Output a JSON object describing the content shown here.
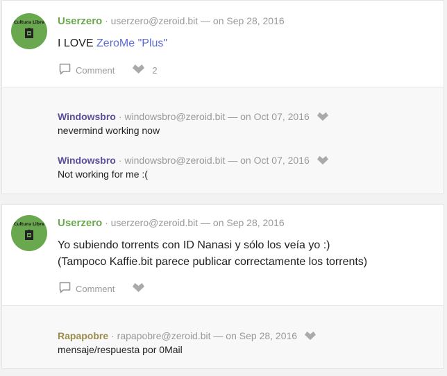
{
  "posts": [
    {
      "avatar_text": "Cultura Libre",
      "username": "Userzero",
      "address": "· userzero@zeroid.bit — on Sep 28, 2016",
      "text_prefix": "I LOVE ",
      "text_link": "ZeroMe \"Plus\"",
      "comment_label": "Comment",
      "like_count": "2",
      "replies": [
        {
          "username": "Windowsbro",
          "meta": "· windowsbro@zeroid.bit — on Oct 07, 2016",
          "text": "nevermind working now"
        },
        {
          "username": "Windowsbro",
          "meta": "· windowsbro@zeroid.bit — on Oct 07, 2016",
          "text": "Not working for me :("
        }
      ]
    },
    {
      "avatar_text": "Cultura Libre",
      "username": "Userzero",
      "address": "· userzero@zeroid.bit — on Sep 28, 2016",
      "line1": "Yo subiendo torrents con ID Nanasi y sólo los veía yo :)",
      "line2": "(Tampoco Kaffie.bit parece publicar correctamente los torrents)",
      "comment_label": "Comment",
      "replies": [
        {
          "username": "Rapapobre",
          "meta": "· rapapobre@zeroid.bit — on Sep 28, 2016",
          "text": "mensaje/respuesta por 0Mail"
        }
      ]
    }
  ],
  "colors": {
    "accent_green": "#6aa84f",
    "link_blue": "#5c6bd8",
    "reply_purple": "#5a4f9c",
    "reply_olive": "#9c8b4a"
  },
  "icons": [
    "comment-icon",
    "heart-icon"
  ]
}
